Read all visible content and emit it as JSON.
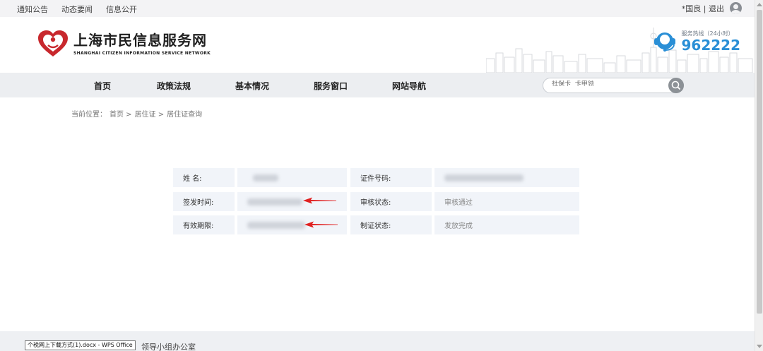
{
  "topbar": {
    "links": [
      "通知公告",
      "动态要闻",
      "信息公开"
    ],
    "user": "*国良",
    "separator": "|",
    "logout": "退出"
  },
  "header": {
    "logo_cn": "上海市民信息服务网",
    "logo_en": "SHANGHAI CITIZEN INFORMATION SERVICE NETWORK",
    "hotline_label": "服务热线（24小时）",
    "hotline_number": "962222"
  },
  "nav": {
    "items": [
      "首页",
      "政策法规",
      "基本情况",
      "服务窗口",
      "网站导航"
    ],
    "search_placeholder": "社保卡  卡申领"
  },
  "breadcrumb": {
    "prefix": "当前位置：",
    "items": [
      "首页 >",
      "居住证 >",
      "居住证查询"
    ]
  },
  "info": {
    "name_label": "姓 名:",
    "id_label": "证件号码:",
    "issue_label": "签发时间:",
    "review_label": "审核状态:",
    "review_value": "审核通过",
    "valid_label": "有效期限:",
    "make_label": "制证状态:",
    "make_value": "发放完成"
  },
  "footer": {
    "text": "领导小组办公室",
    "tooltip": "个税网上下载方式(1).docx - WPS Office"
  },
  "colors": {
    "accent_blue": "#2a8fd6",
    "logo_red": "#c8282d",
    "arrow_red": "#e02020",
    "cell_bg": "#f1f4f9"
  }
}
